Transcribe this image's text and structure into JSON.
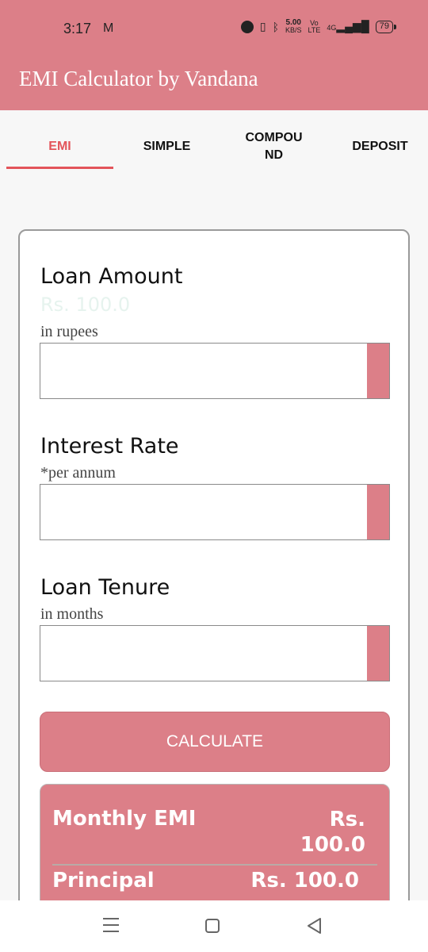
{
  "status_bar": {
    "time": "3:17",
    "mail_icon": "M",
    "speed": "5.00",
    "speed_unit": "KB/S",
    "volte": "Vo",
    "lte": "LTE",
    "network": "4G",
    "battery": "79"
  },
  "app": {
    "title": "EMI Calculator by Vandana",
    "accent_color": "#dc7f88",
    "tab_active_color": "#e3545a"
  },
  "tabs": [
    {
      "label": "EMI"
    },
    {
      "label": "SIMPLE"
    },
    {
      "label": "COMPOU\nND"
    },
    {
      "label": "DEPOSIT"
    }
  ],
  "form": {
    "loan_amount": {
      "label": "Loan Amount",
      "preview": "Rs. 100.0",
      "hint": "in rupees",
      "value": ""
    },
    "interest_rate": {
      "label": "Interest Rate",
      "hint": "*per annum",
      "value": ""
    },
    "loan_tenure": {
      "label": "Loan Tenure",
      "hint": "in months",
      "value": ""
    },
    "calculate_label": "CALCULATE"
  },
  "results": {
    "monthly_emi_label": "Monthly EMI",
    "monthly_emi_value": "Rs.\n100.0",
    "principal_label": "Principal",
    "principal_value": "Rs. 100.0"
  }
}
